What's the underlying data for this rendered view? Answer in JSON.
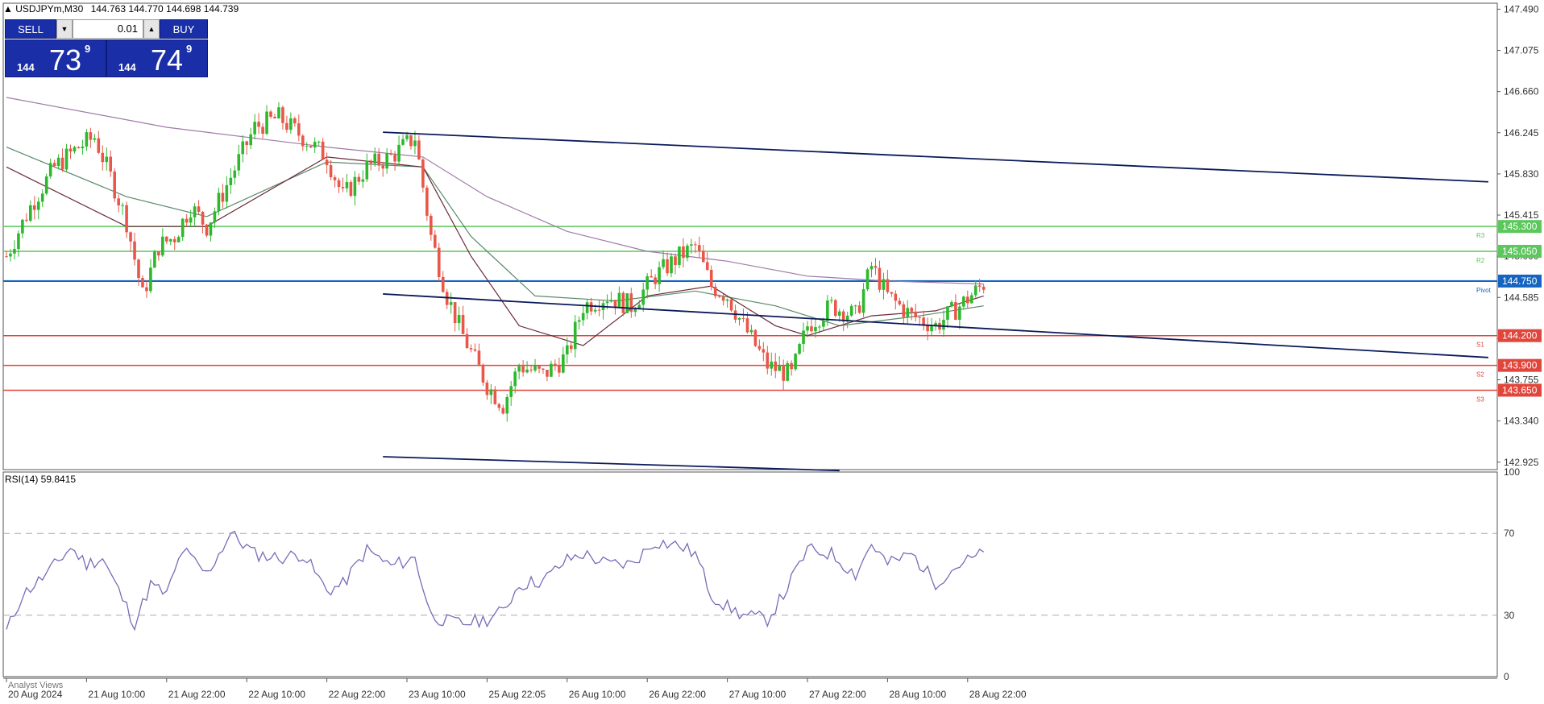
{
  "header": {
    "symbol": "USDJPYm,M30",
    "ohlc": "144.763 144.770 144.698 144.739",
    "indicator_label": "RSI(14) 59.8415",
    "footer_text": "Analyst Views"
  },
  "trade_panel": {
    "sell_label": "SELL",
    "buy_label": "BUY",
    "lot": "0.01",
    "sell_big": "144",
    "sell_main": "73",
    "sell_sup": "9",
    "buy_big": "144",
    "buy_main": "74",
    "buy_sup": "9"
  },
  "colors": {
    "bull": "#2db82d",
    "bear": "#e8574a",
    "pivot": "#1565c0",
    "resistance": "#5cc75c",
    "support": "#e0463c",
    "trend": "#0a1a5a",
    "rsi": "#7a6ab8"
  },
  "chart_data": [
    {
      "type": "candlestick",
      "title": "USDJPYm,M30",
      "x_ticks": [
        "20 Aug 2024",
        "21 Aug 10:00",
        "21 Aug 22:00",
        "22 Aug 10:00",
        "22 Aug 22:00",
        "23 Aug 10:00",
        "25 Aug 22:05",
        "26 Aug 10:00",
        "26 Aug 22:00",
        "27 Aug 10:00",
        "27 Aug 22:00",
        "28 Aug 10:00",
        "28 Aug 22:00"
      ],
      "y_ticks": [
        147.49,
        147.075,
        146.66,
        146.245,
        145.83,
        145.415,
        145.0,
        144.585,
        144.17,
        143.755,
        143.34,
        142.925
      ],
      "ylim": [
        142.85,
        147.55
      ],
      "close_path": [
        [
          0,
          145.0
        ],
        [
          3,
          145.5
        ],
        [
          6,
          145.9
        ],
        [
          9,
          146.1
        ],
        [
          11,
          146.2
        ],
        [
          13,
          145.8
        ],
        [
          15,
          145.35
        ],
        [
          17,
          144.6
        ],
        [
          19,
          145.1
        ],
        [
          21,
          145.2
        ],
        [
          23,
          145.5
        ],
        [
          25,
          145.3
        ],
        [
          28,
          145.8
        ],
        [
          31,
          146.3
        ],
        [
          34,
          146.4
        ],
        [
          37,
          146.2
        ],
        [
          40,
          146.0
        ],
        [
          42,
          145.6
        ],
        [
          45,
          145.9
        ],
        [
          48,
          146.0
        ],
        [
          51,
          146.2
        ],
        [
          53,
          145.2
        ],
        [
          55,
          144.6
        ],
        [
          57,
          144.2
        ],
        [
          60,
          143.7
        ],
        [
          62,
          143.5
        ],
        [
          64,
          143.9
        ],
        [
          67,
          143.8
        ],
        [
          70,
          144.0
        ],
        [
          72,
          144.5
        ],
        [
          75,
          144.6
        ],
        [
          78,
          144.5
        ],
        [
          81,
          144.8
        ],
        [
          84,
          145.0
        ],
        [
          86,
          145.1
        ],
        [
          88,
          144.7
        ],
        [
          90,
          144.6
        ],
        [
          92,
          144.3
        ],
        [
          95,
          143.9
        ],
        [
          98,
          143.8
        ],
        [
          100,
          144.3
        ],
        [
          103,
          144.5
        ],
        [
          106,
          144.4
        ],
        [
          108,
          144.9
        ],
        [
          110,
          144.6
        ],
        [
          113,
          144.4
        ],
        [
          116,
          144.3
        ],
        [
          119,
          144.5
        ],
        [
          122,
          144.72
        ]
      ],
      "moving_averages": [
        {
          "path": [
            [
              0,
              146.6
            ],
            [
              20,
              146.3
            ],
            [
              40,
              146.1
            ],
            [
              52,
              146.0
            ],
            [
              60,
              145.6
            ],
            [
              70,
              145.25
            ],
            [
              80,
              145.05
            ],
            [
              90,
              144.95
            ],
            [
              100,
              144.8
            ],
            [
              110,
              144.75
            ],
            [
              122,
              144.72
            ]
          ],
          "color": "#a07aa8"
        },
        {
          "path": [
            [
              0,
              146.1
            ],
            [
              15,
              145.6
            ],
            [
              25,
              145.4
            ],
            [
              40,
              145.95
            ],
            [
              52,
              145.9
            ],
            [
              58,
              145.2
            ],
            [
              66,
              144.6
            ],
            [
              76,
              144.55
            ],
            [
              86,
              144.65
            ],
            [
              96,
              144.5
            ],
            [
              104,
              144.3
            ],
            [
              114,
              144.4
            ],
            [
              122,
              144.5
            ]
          ],
          "color": "#5a8a6a"
        },
        {
          "path": [
            [
              0,
              145.9
            ],
            [
              15,
              145.3
            ],
            [
              25,
              145.3
            ],
            [
              40,
              146.0
            ],
            [
              52,
              145.9
            ],
            [
              58,
              145.0
            ],
            [
              64,
              144.3
            ],
            [
              72,
              144.1
            ],
            [
              80,
              144.6
            ],
            [
              88,
              144.7
            ],
            [
              96,
              144.3
            ],
            [
              100,
              144.2
            ],
            [
              108,
              144.4
            ],
            [
              116,
              144.45
            ],
            [
              122,
              144.6
            ]
          ],
          "color": "#6a2a3a"
        }
      ],
      "levels": [
        {
          "label": "R3",
          "value": 145.3,
          "tag": "145.300",
          "kind": "resistance"
        },
        {
          "label": "R2",
          "value": 145.05,
          "tag": "145.050",
          "kind": "resistance"
        },
        {
          "label": "Pivot",
          "value": 144.75,
          "tag": "144.750",
          "kind": "pivot"
        },
        {
          "label": "S1",
          "value": 144.2,
          "tag": "144.200",
          "kind": "support"
        },
        {
          "label": "S2",
          "value": 143.9,
          "tag": "143.900",
          "kind": "support"
        },
        {
          "label": "S3",
          "value": 143.65,
          "tag": "143.650",
          "kind": "support"
        }
      ],
      "trendlines": [
        {
          "from": [
            47,
            146.25
          ],
          "to": [
            185,
            145.75
          ]
        },
        {
          "from": [
            47,
            144.62
          ],
          "to": [
            185,
            143.98
          ]
        },
        {
          "from": [
            47,
            142.98
          ],
          "to": [
            104,
            142.84
          ]
        }
      ]
    },
    {
      "type": "line",
      "title": "RSI(14) 59.8415",
      "y_ticks": [
        100,
        70,
        30,
        0
      ],
      "ylim": [
        0,
        100
      ],
      "levels": [
        70,
        30
      ],
      "path": [
        [
          0,
          22
        ],
        [
          2,
          40
        ],
        [
          5,
          50
        ],
        [
          8,
          63
        ],
        [
          10,
          55
        ],
        [
          12,
          58
        ],
        [
          14,
          42
        ],
        [
          16,
          26
        ],
        [
          18,
          45
        ],
        [
          20,
          40
        ],
        [
          22,
          62
        ],
        [
          25,
          50
        ],
        [
          28,
          70
        ],
        [
          31,
          60
        ],
        [
          34,
          58
        ],
        [
          37,
          60
        ],
        [
          40,
          42
        ],
        [
          42,
          45
        ],
        [
          45,
          62
        ],
        [
          48,
          54
        ],
        [
          51,
          58
        ],
        [
          53,
          30
        ],
        [
          55,
          27
        ],
        [
          57,
          26
        ],
        [
          60,
          28
        ],
        [
          62,
          32
        ],
        [
          64,
          45
        ],
        [
          67,
          47
        ],
        [
          70,
          57
        ],
        [
          72,
          60
        ],
        [
          75,
          55
        ],
        [
          78,
          55
        ],
        [
          81,
          66
        ],
        [
          84,
          64
        ],
        [
          86,
          60
        ],
        [
          88,
          40
        ],
        [
          90,
          34
        ],
        [
          92,
          30
        ],
        [
          95,
          28
        ],
        [
          97,
          40
        ],
        [
          100,
          62
        ],
        [
          103,
          60
        ],
        [
          106,
          50
        ],
        [
          108,
          65
        ],
        [
          110,
          55
        ],
        [
          113,
          60
        ],
        [
          116,
          46
        ],
        [
          119,
          55
        ],
        [
          122,
          60
        ]
      ]
    }
  ],
  "x_tick_index": [
    0,
    10,
    20,
    30,
    40,
    50,
    60,
    70,
    80,
    90,
    100,
    110,
    120
  ]
}
